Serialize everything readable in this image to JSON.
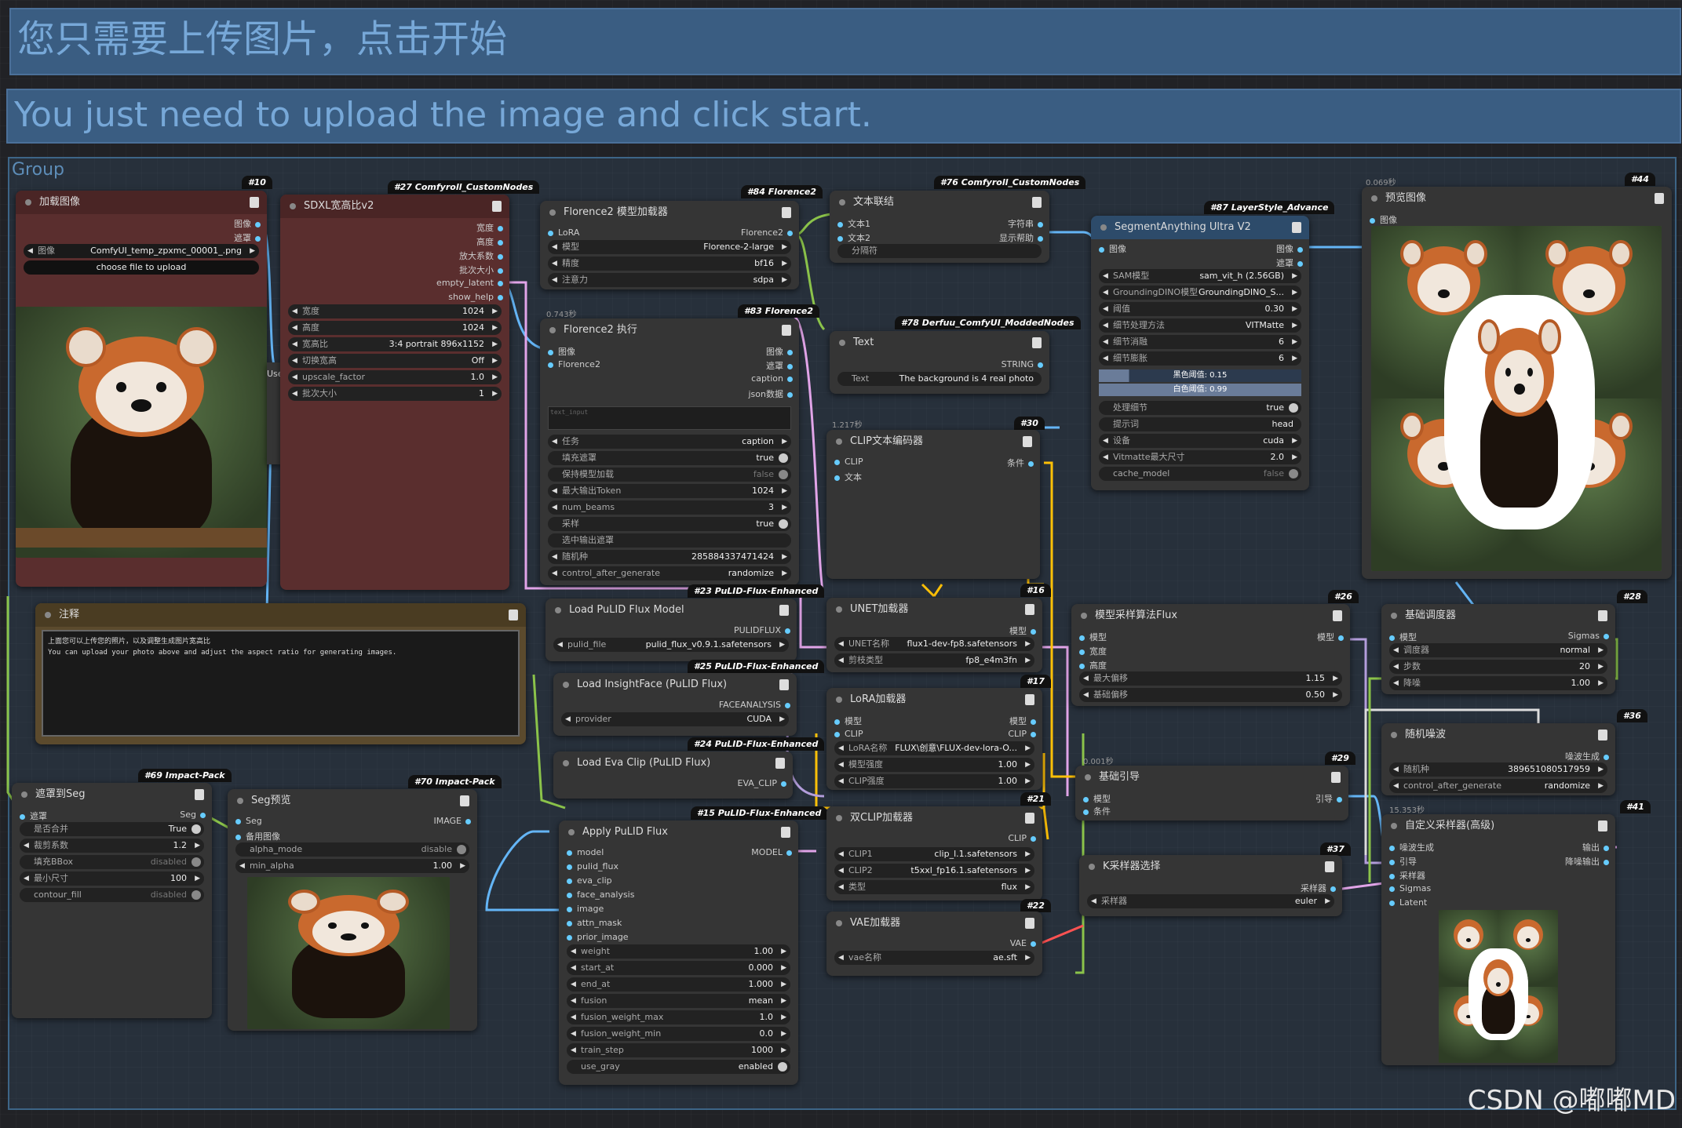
{
  "banner_cn": "您只需要上传图片，点击开始",
  "banner_en": "You just need to upload the image and click start.",
  "group_title": "Group",
  "watermark": "CSDN @嘟嘟MD",
  "n10": {
    "badge": "#10",
    "title": "加载图像",
    "o1": "图像",
    "o2": "遮罩",
    "image": "ComfyUI_temp_zpxmc_00001_.png",
    "upload": "choose file to upload",
    "img_k": "图像"
  },
  "n27": {
    "badge": "#27 Comfyroll_CustomNodes",
    "title": "SDXL宽高比v2",
    "outs": [
      "宽度",
      "高度",
      "放大系数",
      "批次大小",
      "empty_latent",
      "show_help"
    ],
    "w": [
      [
        "宽度",
        "1024"
      ],
      [
        "高度",
        "1024"
      ],
      [
        "宽高比",
        "3:4 portrait 896x1152"
      ],
      [
        "切换宽高",
        "Off"
      ],
      [
        "upscale_factor",
        "1.0"
      ],
      [
        "批次大小",
        "1"
      ]
    ]
  },
  "n84": {
    "badge": "#84 Florence2",
    "title": "Florence2 模型加载器",
    "in1": "LoRA",
    "out1": "Florence2",
    "w": [
      [
        "模型",
        "Florence-2-large"
      ],
      [
        "精度",
        "bf16"
      ],
      [
        "注意力",
        "sdpa"
      ]
    ]
  },
  "n83": {
    "badge": "#83 Florence2",
    "time": "0.743秒",
    "title": "Florence2 执行",
    "ins": [
      "图像",
      "Florence2"
    ],
    "outs": [
      "图像",
      "遮罩",
      "caption",
      "json数据"
    ],
    "ta": "text_input",
    "w": [
      [
        "任务",
        "caption"
      ],
      [
        "填充遮罩",
        "true"
      ],
      [
        "保持模型加载",
        "false"
      ],
      [
        "最大输出Token",
        "1024"
      ],
      [
        "num_beams",
        "3"
      ],
      [
        "采样",
        "true"
      ],
      [
        "选中输出遮罩",
        ""
      ],
      [
        "随机种",
        "285884337471424"
      ],
      [
        "control_after_generate",
        "randomize"
      ]
    ]
  },
  "n76": {
    "badge": "#76 Comfyroll_CustomNodes",
    "title": "文本联结",
    "ins": [
      "文本1",
      "文本2"
    ],
    "outs": [
      "字符串",
      "显示帮助"
    ],
    "sep": "分隔符"
  },
  "n78": {
    "badge": "#78 Derfuu_ComfyUI_ModdedNodes",
    "title": "Text",
    "out": "STRING",
    "wk": "Text",
    "wv": "The background is 4 real photo"
  },
  "n30": {
    "badge": "#30",
    "time": "1.217秒",
    "title": "CLIP文本编码器",
    "ins": [
      "CLIP",
      "文本"
    ],
    "out": "条件"
  },
  "n87": {
    "badge": "#87 LayerStyle_Advance",
    "title": "SegmentAnything Ultra V2",
    "in": "图像",
    "outs": [
      "图像",
      "遮罩"
    ],
    "w": [
      [
        "SAM模型",
        "sam_vit_h (2.56GB)"
      ],
      [
        "GroundingDINO模型",
        "GroundingDINO_S..."
      ],
      [
        "阈值",
        "0.30"
      ],
      [
        "细节处理方法",
        "VITMatte"
      ],
      [
        "细节消融",
        "6"
      ],
      [
        "细节膨胀",
        "6"
      ]
    ],
    "b1": "黑色阈值: 0.15",
    "b2": "白色阈值: 0.99",
    "w2": [
      [
        "处理细节",
        "true"
      ],
      [
        "提示词",
        "head"
      ],
      [
        "设备",
        "cuda"
      ],
      [
        "Vitmatte最大尺寸",
        "2.0"
      ],
      [
        "cache_model",
        "false"
      ]
    ]
  },
  "n44": {
    "badge": "#44",
    "time": "0.069秒",
    "title": "预览图像",
    "in": "图像"
  },
  "note": {
    "title": "注释",
    "line1": "上面您可以上传您的照片，以及调整生成图片宽高比",
    "line2": "You can upload your photo above and adjust the aspect ratio for generating images."
  },
  "n23": {
    "badge": "#23 PuLID-Flux-Enhanced",
    "title": "Load PuLID Flux Model",
    "out": "PULIDFLUX",
    "wk": "pulid_file",
    "wv": "pulid_flux_v0.9.1.safetensors"
  },
  "n25": {
    "badge": "#25 PuLID-Flux-Enhanced",
    "title": "Load InsightFace (PuLID Flux)",
    "out": "FACEANALYSIS",
    "wk": "provider",
    "wv": "CUDA"
  },
  "n24": {
    "badge": "#24 PuLID-Flux-Enhanced",
    "title": "Load Eva Clip (PuLID Flux)",
    "out": "EVA_CLIP"
  },
  "n15": {
    "badge": "#15 PuLID-Flux-Enhanced",
    "title": "Apply PuLID Flux",
    "ins": [
      "model",
      "pulid_flux",
      "eva_clip",
      "face_analysis",
      "image",
      "attn_mask",
      "prior_image"
    ],
    "out": "MODEL",
    "w": [
      [
        "weight",
        "1.00"
      ],
      [
        "start_at",
        "0.000"
      ],
      [
        "end_at",
        "1.000"
      ],
      [
        "fusion",
        "mean"
      ],
      [
        "fusion_weight_max",
        "1.0"
      ],
      [
        "fusion_weight_min",
        "0.0"
      ],
      [
        "train_step",
        "1000"
      ],
      [
        "use_gray",
        "enabled"
      ]
    ]
  },
  "n16": {
    "badge": "#16",
    "title": "UNET加载器",
    "out": "模型",
    "w": [
      [
        "UNET名称",
        "flux1-dev-fp8.safetensors"
      ],
      [
        "剪枝类型",
        "fp8_e4m3fn"
      ]
    ]
  },
  "n17": {
    "badge": "#17",
    "title": "LoRA加载器",
    "ins": [
      "模型",
      "CLIP"
    ],
    "outs": [
      "模型",
      "CLIP"
    ],
    "w": [
      [
        "LoRA名称",
        "FLUX\\创意\\FLUX-dev-lora-O..."
      ],
      [
        "模型强度",
        "1.00"
      ],
      [
        "CLIP强度",
        "1.00"
      ]
    ]
  },
  "n21": {
    "badge": "#21",
    "title": "双CLIP加载器",
    "out": "CLIP",
    "w": [
      [
        "CLIP1",
        "clip_l.1.safetensors"
      ],
      [
        "CLIP2",
        "t5xxl_fp16.1.safetensors"
      ],
      [
        "类型",
        "flux"
      ]
    ]
  },
  "n22": {
    "badge": "#22",
    "title": "VAE加载器",
    "out": "VAE",
    "wk": "vae名称",
    "wv": "ae.sft"
  },
  "n26": {
    "badge": "#26",
    "title": "模型采样算法Flux",
    "ins": [
      "模型",
      "宽度",
      "高度"
    ],
    "out": "模型",
    "w": [
      [
        "最大偏移",
        "1.15"
      ],
      [
        "基础偏移",
        "0.50"
      ]
    ]
  },
  "n29": {
    "badge": "#29",
    "time": "0.001秒",
    "title": "基础引导",
    "ins": [
      "模型",
      "条件"
    ],
    "out": "引导"
  },
  "n37": {
    "badge": "#37",
    "title": "K采样器选择",
    "out": "采样器",
    "wk": "采样器",
    "wv": "euler"
  },
  "n28": {
    "badge": "#28",
    "title": "基础调度器",
    "in": "模型",
    "out": "Sigmas",
    "w": [
      [
        "调度器",
        "normal"
      ],
      [
        "步数",
        "20"
      ],
      [
        "降噪",
        "1.00"
      ]
    ]
  },
  "n36": {
    "badge": "#36",
    "title": "随机噪波",
    "out": "噪波生成",
    "w": [
      [
        "随机种",
        "389651080517959"
      ],
      [
        "control_after_generate",
        "randomize"
      ]
    ]
  },
  "n41": {
    "badge": "#41",
    "time": "15.353秒",
    "title": "自定义采样器(高级)",
    "ins": [
      "噪波生成",
      "引导",
      "采样器",
      "Sigmas",
      "Latent"
    ],
    "outs": [
      "输出",
      "降噪输出"
    ]
  },
  "n69": {
    "badge": "#69 Impact-Pack",
    "title": "遮罩到Seg",
    "in": "遮罩",
    "out": "Seg",
    "w": [
      [
        "是否合并",
        "True"
      ],
      [
        "裁剪系数",
        "1.2"
      ],
      [
        "填充BBox",
        "disabled"
      ],
      [
        "最小尺寸",
        "100"
      ],
      [
        "contour_fill",
        "disabled"
      ]
    ]
  },
  "n70": {
    "badge": "#70 Impact-Pack",
    "title": "Seg预览",
    "ins": [
      "Seg",
      "备用图像"
    ],
    "out": "IMAGE",
    "w": [
      [
        "alpha_mode",
        "disable"
      ],
      [
        "min_alpha",
        "1.00"
      ]
    ]
  },
  "use_label": "Use"
}
